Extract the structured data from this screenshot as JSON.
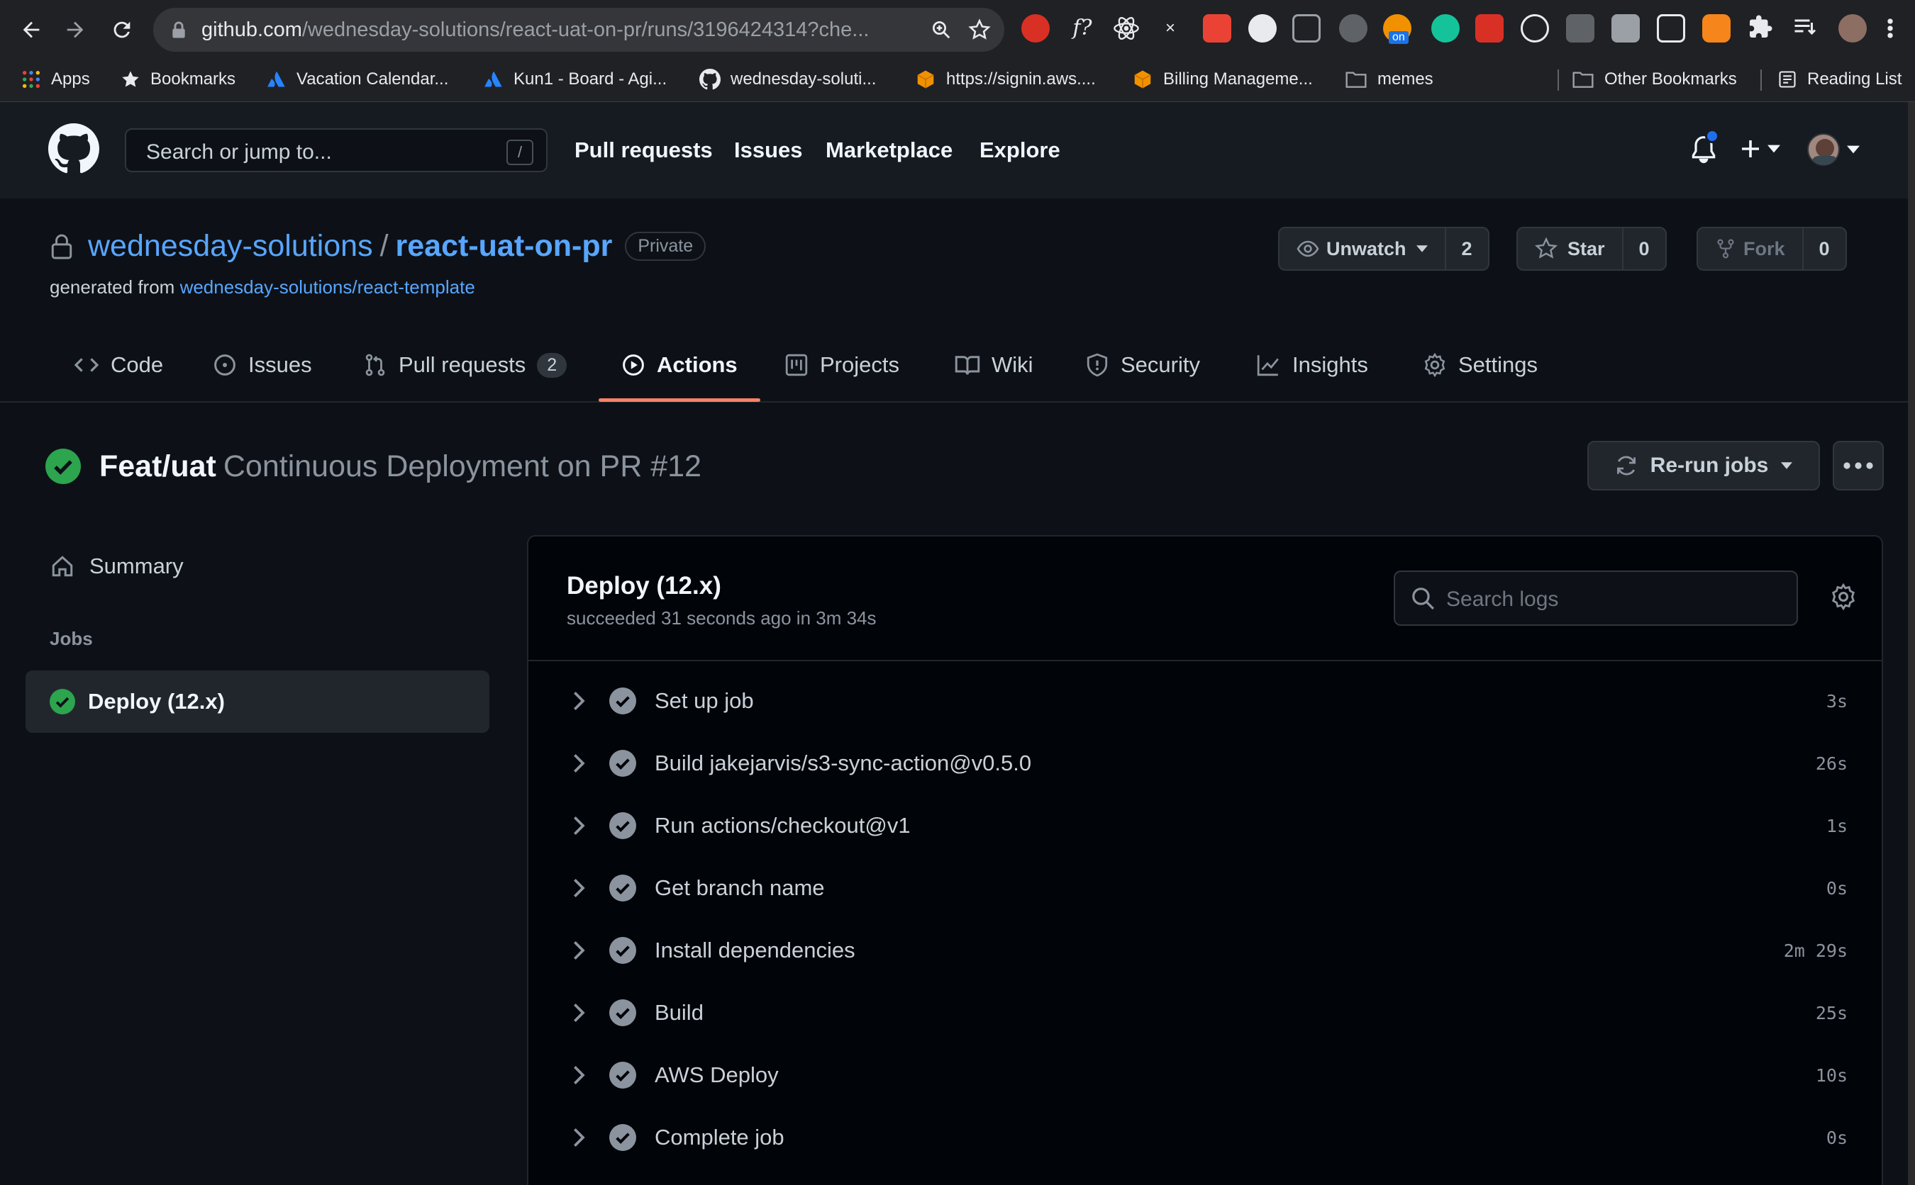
{
  "browser": {
    "url_host": "github.com",
    "url_path": "/wednesday-solutions/react-uat-on-pr/runs/3196424314?che...",
    "bookmarks": [
      {
        "label": "Apps",
        "color": "#ea4335"
      },
      {
        "label": "Bookmarks",
        "color": "#e8eaed"
      },
      {
        "label": "Vacation Calendar...",
        "color": "#2684ff"
      },
      {
        "label": "Kun1 - Board - Agi...",
        "color": "#2684ff"
      },
      {
        "label": "wednesday-soluti...",
        "color": "#e8eaed"
      },
      {
        "label": "https://signin.aws....",
        "color": "#f29100"
      },
      {
        "label": "Billing Manageme...",
        "color": "#f29100"
      },
      {
        "label": "memes",
        "color": "#9aa0a6"
      },
      {
        "label": "Other Bookmarks",
        "color": "#9aa0a6"
      },
      {
        "label": "Reading List",
        "color": "#9aa0a6"
      }
    ],
    "extension_badge": "on"
  },
  "header": {
    "search_placeholder": "Search or jump to...",
    "search_shortcut": "/",
    "nav": [
      "Pull requests",
      "Issues",
      "Marketplace",
      "Explore"
    ]
  },
  "repo": {
    "owner": "wednesday-solutions",
    "separator": "/",
    "name": "react-uat-on-pr",
    "visibility": "Private",
    "generated_from_label": "generated from",
    "generated_from_link": "wednesday-solutions/react-template",
    "watch": {
      "label": "Unwatch",
      "count": "2"
    },
    "star": {
      "label": "Star",
      "count": "0"
    },
    "fork": {
      "label": "Fork",
      "count": "0"
    }
  },
  "tabs": [
    {
      "label": "Code",
      "icon": "code-icon"
    },
    {
      "label": "Issues",
      "icon": "issue-icon"
    },
    {
      "label": "Pull requests",
      "icon": "pull-request-icon",
      "counter": "2"
    },
    {
      "label": "Actions",
      "icon": "play-icon",
      "selected": true
    },
    {
      "label": "Projects",
      "icon": "project-icon"
    },
    {
      "label": "Wiki",
      "icon": "book-icon"
    },
    {
      "label": "Security",
      "icon": "shield-icon"
    },
    {
      "label": "Insights",
      "icon": "graph-icon"
    },
    {
      "label": "Settings",
      "icon": "gear-icon"
    }
  ],
  "run": {
    "branch": "Feat/uat",
    "description": "Continuous Deployment on PR #12",
    "rerun_label": "Re-run jobs"
  },
  "sidebar": {
    "summary_label": "Summary",
    "jobs_heading": "Jobs",
    "job_label": "Deploy (12.x)"
  },
  "job": {
    "name": "Deploy (12.x)",
    "meta": "succeeded 31 seconds ago in 3m 34s",
    "search_placeholder": "Search logs",
    "steps": [
      {
        "label": "Set up job",
        "duration": "3s"
      },
      {
        "label": "Build jakejarvis/s3-sync-action@v0.5.0",
        "duration": "26s"
      },
      {
        "label": "Run actions/checkout@v1",
        "duration": "1s"
      },
      {
        "label": "Get branch name",
        "duration": "0s"
      },
      {
        "label": "Install dependencies",
        "duration": "2m 29s"
      },
      {
        "label": "Build",
        "duration": "25s"
      },
      {
        "label": "AWS Deploy",
        "duration": "10s"
      },
      {
        "label": "Complete job",
        "duration": "0s"
      }
    ]
  },
  "colors": {
    "success": "#2da44e",
    "link": "#58a6ff",
    "tab_underline": "#f78166",
    "notification_dot": "#1f6feb"
  }
}
